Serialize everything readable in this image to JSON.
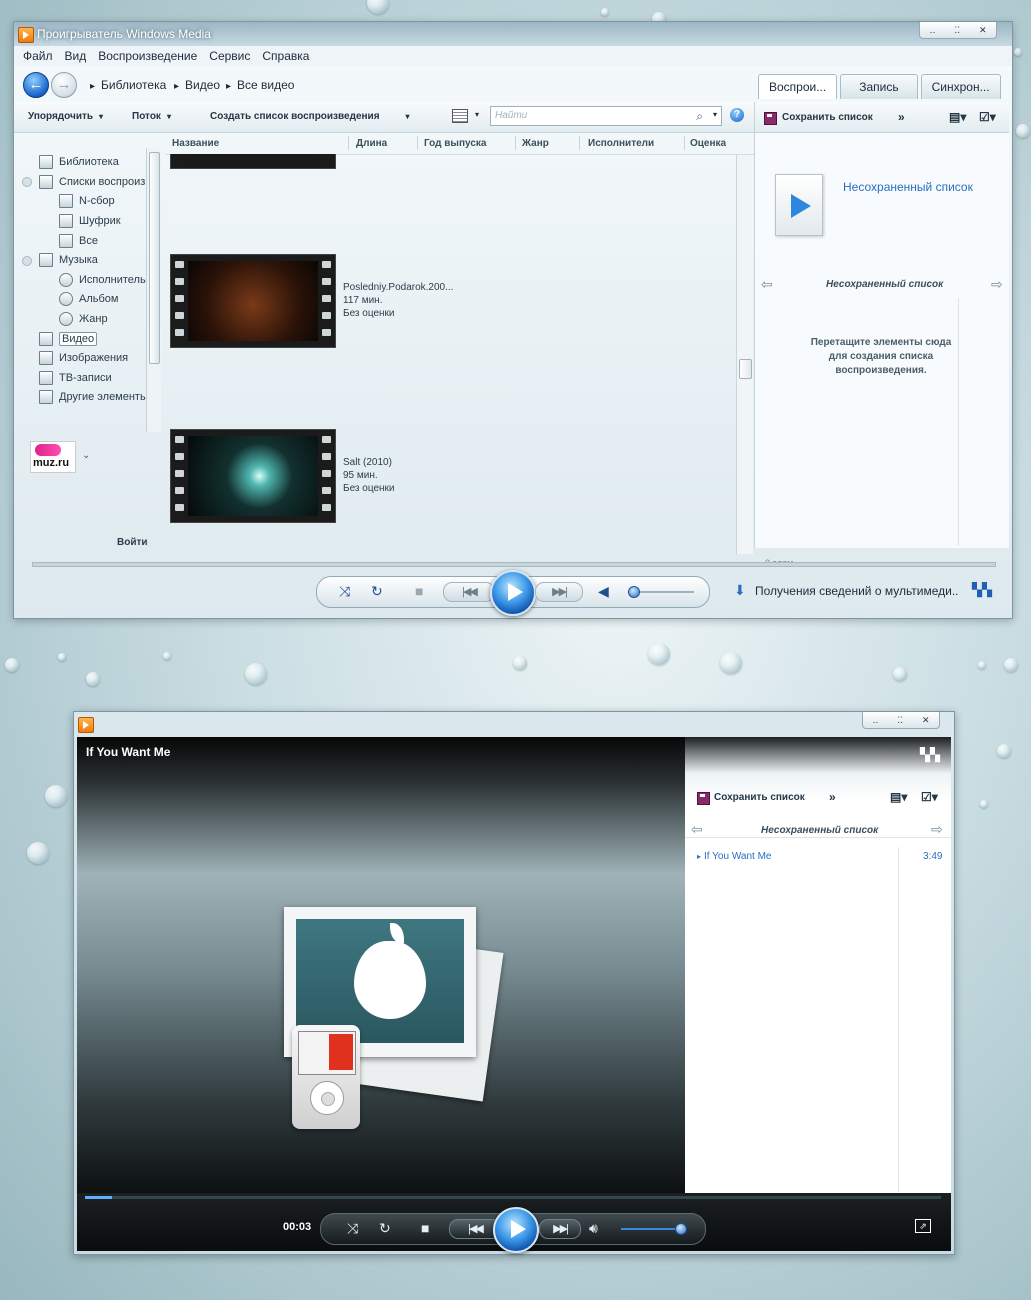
{
  "window1": {
    "title": "Проигрыватель Windows Media",
    "menu": [
      "Файл",
      "Вид",
      "Воспроизведение",
      "Сервис",
      "Справка"
    ],
    "breadcrumb": [
      "Библиотека",
      "Видео",
      "Все видео"
    ],
    "tabs": [
      "Воспрои...",
      "Запись",
      "Синхрон..."
    ],
    "toolbar": {
      "organize": "Упорядочить",
      "stream": "Поток",
      "create_playlist": "Создать список воспроизведения"
    },
    "search_placeholder": "Найти",
    "help": "?",
    "sidebar": {
      "library": "Библиотека",
      "playlists": "Списки воспроиз",
      "playlist_items": [
        "N-сбор",
        "Шуфрик",
        "Все"
      ],
      "music": "Музыка",
      "music_items": [
        "Исполнитель",
        "Альбом",
        "Жанр"
      ],
      "video": "Видео",
      "images": "Изображения",
      "tv": "ТВ-записи",
      "other": "Другие элементы",
      "muz_logo": "muz.ru",
      "login": "Войти"
    },
    "columns": [
      "Название",
      "Длина",
      "Год выпуска",
      "Жанр",
      "Исполнители",
      "Оценка"
    ],
    "videos": [
      {
        "title": "Posledniy.Podarok.200...",
        "duration": "117 мин.",
        "rating": "Без оценки"
      },
      {
        "title": "Salt (2010)",
        "duration": "95 мин.",
        "rating": "Без оценки"
      }
    ],
    "right_pane": {
      "save_list": "Сохранить список",
      "more": "»",
      "unsaved_link": "Несохраненный список",
      "unsaved_title": "Несохраненный список",
      "drag_hint": "Перетащите элементы сюда для создания списка воспроизведения.",
      "items_count": "0 элем."
    },
    "status": "Получения сведений о мультимеди..",
    "volume_level": 0.07
  },
  "window2": {
    "now_playing": "If You Want Me",
    "right_pane": {
      "save_list": "Сохранить список",
      "more": "»",
      "unsaved_title": "Несохраненный список"
    },
    "playlist": [
      {
        "title": "If You Want Me",
        "duration": "3:49"
      }
    ],
    "time": "00:03",
    "progress": 0.032,
    "volume_level": 0.9
  }
}
